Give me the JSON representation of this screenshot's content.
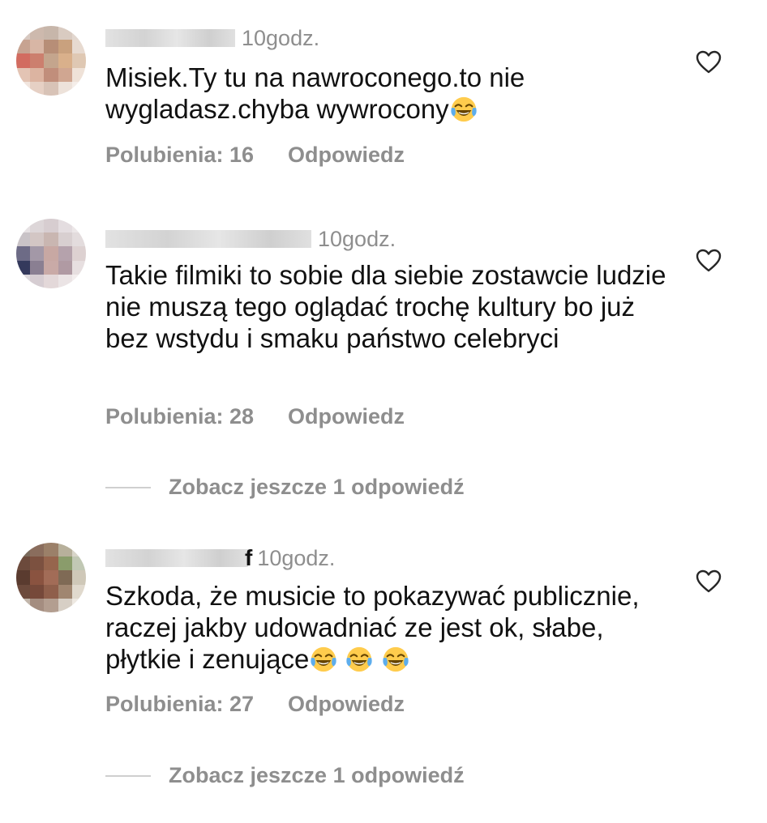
{
  "comments": [
    {
      "time": "10godz.",
      "text": "Misiek.Ty tu na nawroconego.to nie wygladasz.chyba wywrocony",
      "emoji_count": 1,
      "likes_label": "Polubienia: 16",
      "reply_label": "Odpowiedz"
    },
    {
      "time": "10godz.",
      "text": "Takie filmiki to sobie dla siebie zostawcie ludzie nie muszą tego oglądać trochę kultury bo już bez wstydu i smaku państwo celebryci",
      "likes_label": "Polubienia: 28",
      "reply_label": "Odpowiedz",
      "more_replies_label": "Zobacz jeszcze 1 odpowiedź"
    },
    {
      "username_fragment": "f",
      "time": "10godz.",
      "text": "Szkoda, że musicie to pokazywać publicznie, raczej jakby udowadniać ze jest ok, słabe, płytkie i zenujące",
      "emoji_count": 3,
      "likes_label": "Polubienia: 27",
      "reply_label": "Odpowiedz",
      "more_replies_label": "Zobacz jeszcze 1 odpowiedź"
    }
  ],
  "icons": {
    "like": "heart-outline-icon",
    "emoji": "face-with-tears-of-joy-icon"
  },
  "colors": {
    "text": "#111111",
    "secondary": "#8e8e8e",
    "divider": "#cfcfcf"
  }
}
